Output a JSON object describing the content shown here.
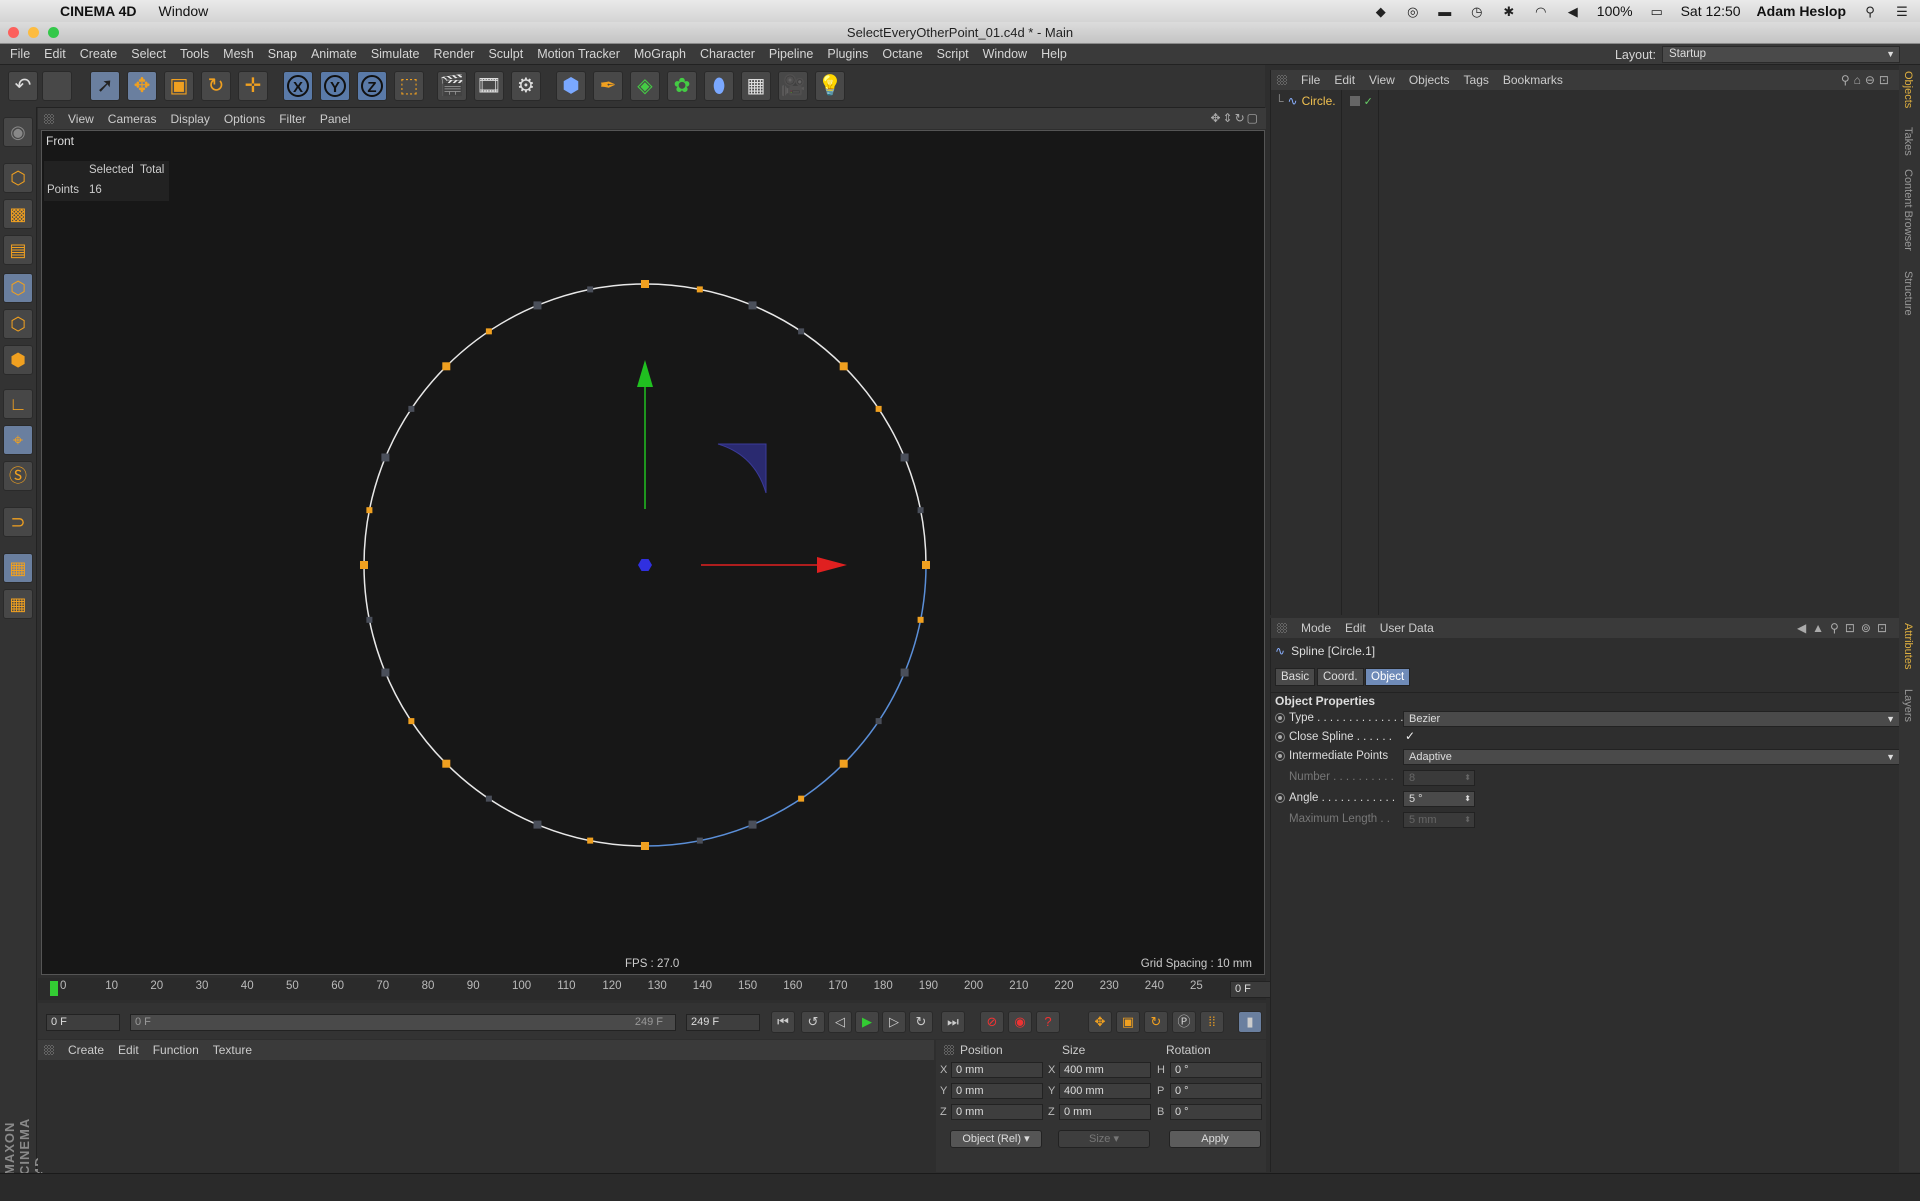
{
  "mac_menubar": {
    "app_name": "CINEMA 4D",
    "menu_window": "Window",
    "battery": "100%",
    "clock": "Sat 12:50",
    "user": "Adam Heslop"
  },
  "window": {
    "title": "SelectEveryOtherPoint_01.c4d * - Main"
  },
  "app_menu": {
    "items": [
      "File",
      "Edit",
      "Create",
      "Select",
      "Tools",
      "Mesh",
      "Snap",
      "Animate",
      "Simulate",
      "Render",
      "Sculpt",
      "Motion Tracker",
      "MoGraph",
      "Character",
      "Pipeline",
      "Plugins",
      "Octane",
      "Script",
      "Window",
      "Help"
    ],
    "layout_label": "Layout:",
    "layout_value": "Startup"
  },
  "toolbar": {
    "axis_x": "X",
    "axis_y": "Y",
    "axis_z": "Z"
  },
  "viewport_menu": {
    "items": [
      "View",
      "Cameras",
      "Display",
      "Options",
      "Filter",
      "Panel"
    ]
  },
  "viewport": {
    "name": "Front",
    "hud_selected": "Selected",
    "hud_total": "Total",
    "hud_points_label": "Points",
    "hud_points_value": "16",
    "fps": "FPS : 27.0",
    "grid_spacing": "Grid Spacing : 10 mm"
  },
  "timeline": {
    "ticks": [
      "0",
      "10",
      "20",
      "30",
      "40",
      "50",
      "60",
      "70",
      "80",
      "90",
      "100",
      "110",
      "120",
      "130",
      "140",
      "150",
      "160",
      "170",
      "180",
      "190",
      "200",
      "210",
      "220",
      "230",
      "240",
      "25"
    ],
    "current_frame": "0 F",
    "start_frame": "0 F",
    "range_start": "0 F",
    "range_end": "249 F",
    "end_frame": "249 F"
  },
  "materials_menu": {
    "items": [
      "Create",
      "Edit",
      "Function",
      "Texture"
    ]
  },
  "coordinates": {
    "head_position": "Position",
    "head_size": "Size",
    "head_rotation": "Rotation",
    "rows": [
      {
        "axis": "X",
        "pos": "0 mm",
        "size_axis": "X",
        "size": "400 mm",
        "rot_axis": "H",
        "rot": "0 °"
      },
      {
        "axis": "Y",
        "pos": "0 mm",
        "size_axis": "Y",
        "size": "400 mm",
        "rot_axis": "P",
        "rot": "0 °"
      },
      {
        "axis": "Z",
        "pos": "0 mm",
        "size_axis": "Z",
        "size": "0 mm",
        "rot_axis": "B",
        "rot": "0 °"
      }
    ],
    "mode": "Object (Rel)",
    "size_mode": "Size",
    "apply": "Apply"
  },
  "objects_panel": {
    "menu": [
      "File",
      "Edit",
      "View",
      "Objects",
      "Tags",
      "Bookmarks"
    ],
    "object_name": "Circle."
  },
  "attributes_panel": {
    "menu": [
      "Mode",
      "Edit",
      "User Data"
    ],
    "object_title": "Spline [Circle.1]",
    "tabs": [
      "Basic",
      "Coord.",
      "Object"
    ],
    "section": "Object Properties",
    "type_label": "Type . . . . . . . . . . . . . .",
    "type_value": "Bezier",
    "close_label": "Close Spline . . . . . .",
    "close_value": "✓",
    "intermediate_label": "Intermediate Points",
    "intermediate_value": "Adaptive",
    "number_label": "Number . . . . . . . . . .",
    "number_value": "8",
    "angle_label": "Angle . . . . . . . . . . . .",
    "angle_value": "5 °",
    "maxlen_label": "Maximum Length . .",
    "maxlen_value": "5 mm"
  },
  "side_tabs": [
    "Objects",
    "Takes",
    "Content Browser",
    "Structure",
    "Attributes",
    "Layers"
  ],
  "branding": "MAXON CINEMA 4D",
  "colors": {
    "spline_white": "#e8e8e8",
    "spline_selected": "#5b8fd8",
    "point_selected": "#f0a020",
    "point_unselected": "#4a4f5a",
    "axis_x": "#e02020",
    "axis_y": "#20c020",
    "axis_center": "#3030e0",
    "accent": "#6f8bb8"
  }
}
